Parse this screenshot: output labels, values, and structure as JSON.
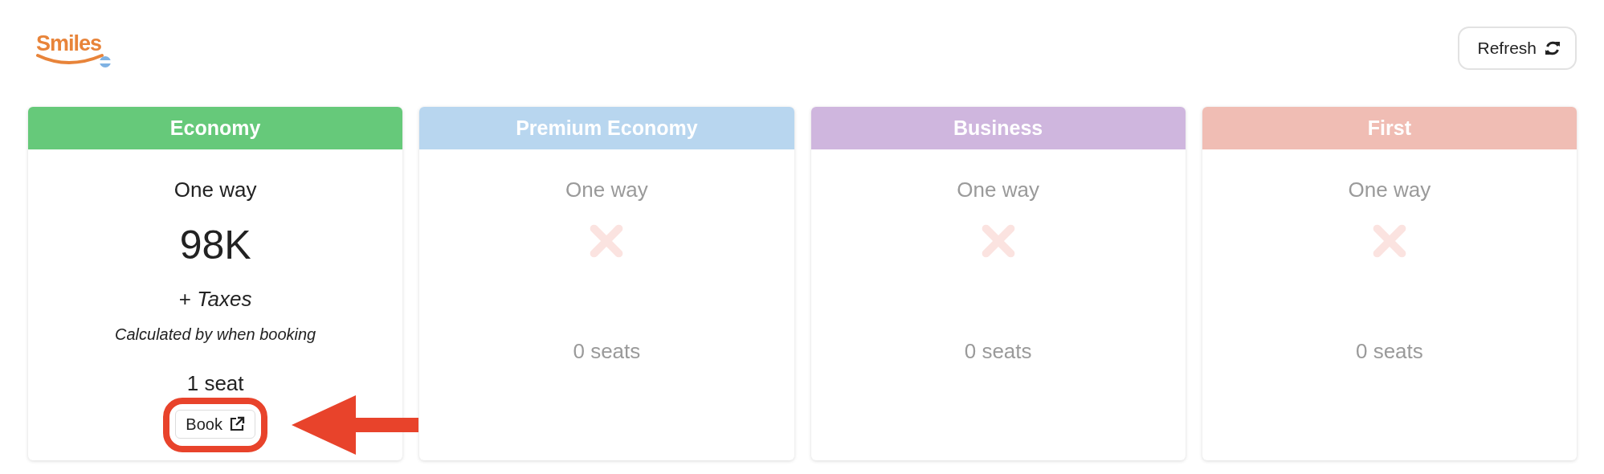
{
  "logo": {
    "text": "Smiles"
  },
  "refresh_button": {
    "label": "Refresh"
  },
  "cards": [
    {
      "title": "Economy",
      "color": "#66c97a",
      "available": true,
      "trip": "One way",
      "price": "98K",
      "taxes": "+ *Taxes*",
      "note": "Calculated by when booking",
      "seats": "1 seat",
      "book_label": "Book"
    },
    {
      "title": "Premium Economy",
      "color": "#b8d6ef",
      "available": false,
      "trip": "One way",
      "seats": "0 seats"
    },
    {
      "title": "Business",
      "color": "#cfb6de",
      "available": false,
      "trip": "One way",
      "seats": "0 seats"
    },
    {
      "title": "First",
      "color": "#f0bdb4",
      "available": false,
      "trip": "One way",
      "seats": "0 seats"
    }
  ]
}
